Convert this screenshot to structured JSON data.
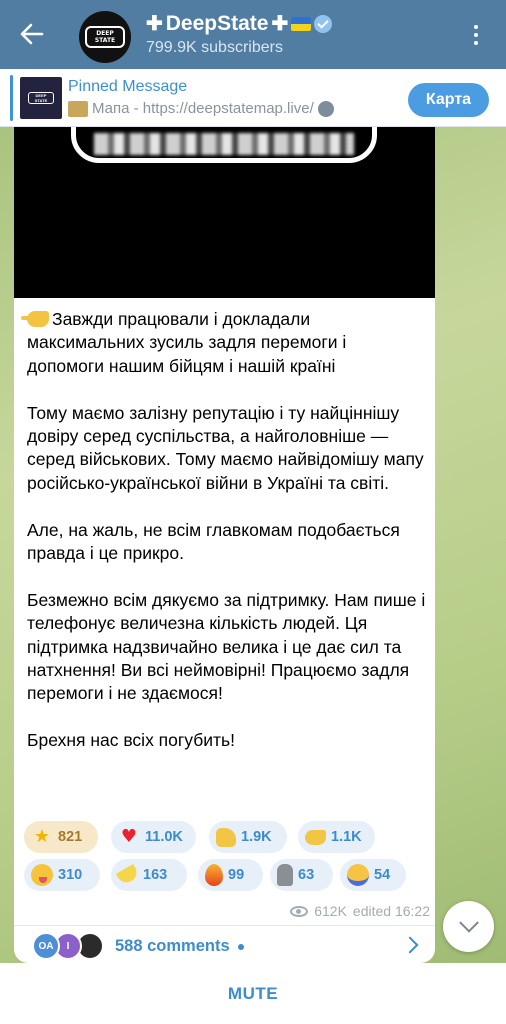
{
  "header": {
    "title": "DeepState",
    "subscribers": "799.9K subscribers",
    "avatar_text": "DEEP STATE"
  },
  "pinned": {
    "title": "Pinned Message",
    "text": "Мапа - https://deepstatemap.live/",
    "button_label": "Карта"
  },
  "message": {
    "paragraphs": [
      "Завжди працювали і докладали максимальних зусиль задля перемоги і допомоги нашим бійцям і нашій країні",
      "Тому маємо залізну репутацію і ту найціннішу довіру серед суспільства, а найголовніше — серед військових. Тому маємо найвідомішу мапу російсько-української війни в Україні та світі.",
      "Але, на жаль, не всім главкомам подобається правда і це прикро.",
      "Безмежно всім дякуємо за підтримку. Нам пише і телефонує величезна кількість людей. Ця підтримка надзвичайно велика і це дає сил та натхнення! Ви всі неймовірні! Працюємо задля перемоги і не здаємося!",
      "Брехня нас всіх погубить!"
    ]
  },
  "reactions": [
    {
      "icon": "star-icon",
      "count": "821"
    },
    {
      "icon": "heart-icon",
      "count": "11.0K"
    },
    {
      "icon": "thumbs-up-icon",
      "count": "1.9K"
    },
    {
      "icon": "pointing-hand-icon",
      "count": "1.1K"
    },
    {
      "icon": "crazy-face-icon",
      "count": "310"
    },
    {
      "icon": "banana-icon",
      "count": "163"
    },
    {
      "icon": "fire-icon",
      "count": "99"
    },
    {
      "icon": "moai-icon",
      "count": "63"
    },
    {
      "icon": "shrug-icon",
      "count": "54"
    }
  ],
  "meta": {
    "views": "612K",
    "edited": "edited 16:22"
  },
  "comments": {
    "label": "588 comments",
    "avatar1": "OA",
    "avatar2": "I"
  },
  "bottom": {
    "mute_label": "MUTE"
  },
  "colors": {
    "header": "#517da2",
    "accent": "#3d8ccc",
    "button": "#4b9ce1"
  }
}
